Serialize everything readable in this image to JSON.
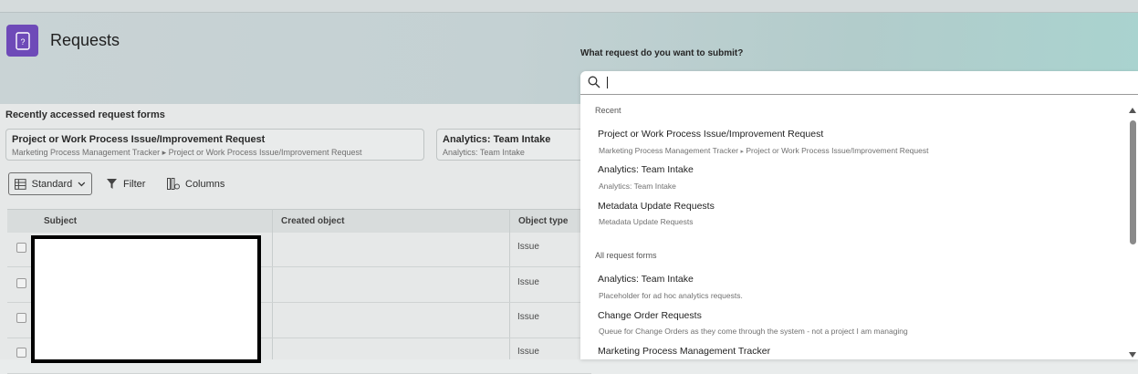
{
  "page": {
    "title": "Requests"
  },
  "recent_forms": {
    "label": "Recently accessed request forms",
    "cards": [
      {
        "title": "Project or Work Process Issue/Improvement Request",
        "path": "Marketing Process Management Tracker ▸ Project or Work Process Issue/Improvement Request"
      },
      {
        "title": "Analytics: Team Intake",
        "path": "Analytics: Team Intake"
      }
    ]
  },
  "toolbar": {
    "view_label": "Standard",
    "filter_label": "Filter",
    "columns_label": "Columns"
  },
  "table": {
    "columns": [
      "Subject",
      "Created object",
      "Object type"
    ],
    "rows": [
      {
        "object_type": "Issue"
      },
      {
        "object_type": "Issue"
      },
      {
        "object_type": "Issue"
      },
      {
        "object_type": "Issue"
      }
    ]
  },
  "picker": {
    "prompt": "What request do you want to submit?",
    "search_value": "",
    "recent_label": "Recent",
    "recent": [
      {
        "title": "Project or Work Process Issue/Improvement Request",
        "sub_a": "Marketing Process Management Tracker",
        "sub_b": "Project or Work Process Issue/Improvement Request"
      },
      {
        "title": "Analytics: Team Intake",
        "sub": "Analytics: Team Intake"
      },
      {
        "title": "Metadata Update Requests",
        "sub": "Metadata Update Requests"
      }
    ],
    "all_label": "All request forms",
    "all": [
      {
        "title": "Analytics: Team Intake",
        "sub": "Placeholder for ad hoc analytics requests."
      },
      {
        "title": "Change Order Requests",
        "sub": "Queue for Change Orders as they come through the system - not a project I am managing"
      },
      {
        "title": "Marketing Process Management Tracker"
      }
    ]
  },
  "colors": {
    "accent": "#6e4ab8"
  }
}
